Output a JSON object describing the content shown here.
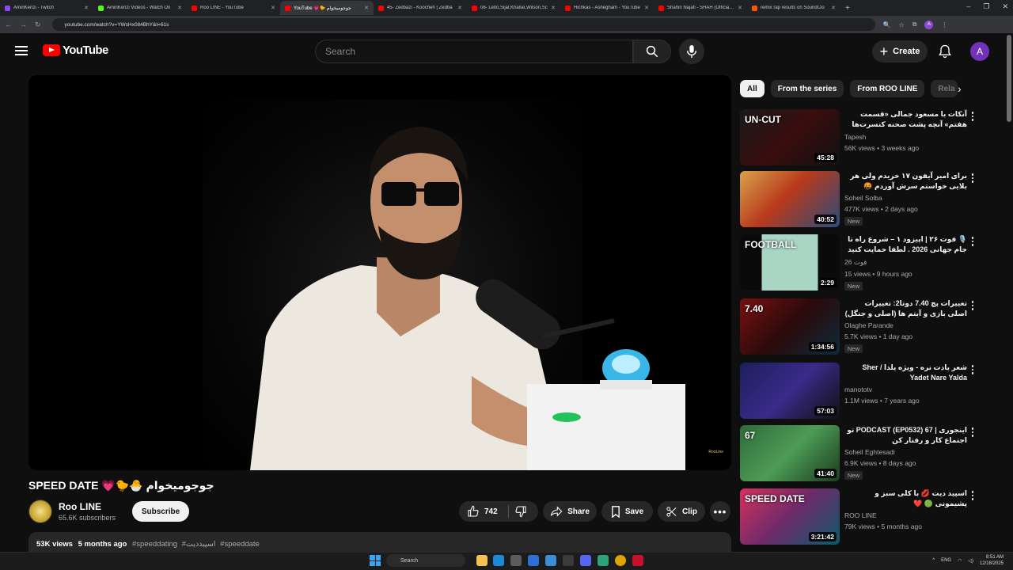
{
  "browser": {
    "tabs": [
      {
        "title": "AminKenzi - Twitch",
        "fav": "tw"
      },
      {
        "title": "AminKenzi Videos - Watch On",
        "fav": "gr"
      },
      {
        "title": "Roo LINE - YouTube",
        "fav": "yt"
      },
      {
        "title": "YouTube 💗🐤 جوجومیخوام",
        "fav": "yt",
        "active": true
      },
      {
        "title": "45- Zedbazi - Koocheh | Zedba",
        "fav": "yt"
      },
      {
        "title": "08- Lelto,Sijal,Khalse,Wilson,Sc",
        "fav": "yt"
      },
      {
        "title": "Hichkas - Ashegham - YouTube",
        "fav": "yt"
      },
      {
        "title": "Shahin Najafi - SHAH (Official M",
        "fav": "yt"
      },
      {
        "title": "remix rap results on SoundClo",
        "fav": "sc"
      }
    ],
    "url": "youtube.com/watch?v=YWsHx084BhY&t=61s",
    "profile_initial": "A"
  },
  "header": {
    "logo_text": "YouTube",
    "search_placeholder": "Search",
    "create_label": "Create",
    "avatar_initial": "A"
  },
  "video": {
    "title": "SPEED DATE 💗🐤🐣 جوجومیخوام",
    "watermark": "RooLine",
    "channel_name": "Roo LINE",
    "subscribers": "65.6K subscribers",
    "subscribe_label": "Subscribe",
    "likes": "742",
    "share_label": "Share",
    "save_label": "Save",
    "clip_label": "Clip",
    "views": "53K views",
    "age": "5 months ago",
    "hashtags": [
      "#speeddating",
      "#اسپیددیت",
      "#speeddate"
    ]
  },
  "chips": [
    "All",
    "From the series",
    "From ROO LINE",
    "Rela"
  ],
  "recommendations": [
    {
      "title": "آنکات با مسعود جمالی «قسمت هفتم» آنچه پشت صحنه کنسرت‌ها گذشت و حرف‌هایی ...",
      "channel": "Tapesh",
      "meta": "56K views • 3 weeks ago",
      "duration": "45:28",
      "new": false,
      "rtl": true,
      "thumb_bg": "linear-gradient(135deg,#1a1a1a 0%,#3a0d0d 50%,#111 100%)",
      "thumb_text": "UN-CUT"
    },
    {
      "title": "برای امیر آیفون ۱۷ خریدم ولی هر بلایی خواستم سرش آوردم 🤬",
      "channel": "Soheil Solba",
      "meta": "477K views • 2 days ago",
      "duration": "40:52",
      "new": true,
      "rtl": true,
      "thumb_bg": "linear-gradient(135deg,#d9a24a 0%,#b83a1c 45%,#2a4c7a 100%)",
      "thumb_text": ""
    },
    {
      "title": "🎙️ فوت ۲۶ | اپیزود ۱ – شروع راه تا جام جهانی 2026 . لطفا حمایت کنید ...",
      "channel": "فوت 26",
      "meta": "15 views • 9 hours ago",
      "duration": "2:29",
      "new": true,
      "rtl": true,
      "thumb_bg": "linear-gradient(90deg,#0a0a0a 0%,#0a0a0a 22%,#a9d6c4 22%,#a9d6c4 78%,#0a0a0a 78%)",
      "thumb_text": "FOOTBALL"
    },
    {
      "title": "تغییرات پچ 7.40 دوتا2: تغییرات اصلی بازی و آیتم ها (اصلی و جنگل)",
      "channel": "Olaghe Parande",
      "meta": "5.7K views • 1 day ago",
      "duration": "1:34:56",
      "new": true,
      "rtl": true,
      "thumb_bg": "linear-gradient(135deg,#7a1010 0%,#2a0a0a 50%,#0d2a3a 100%)",
      "thumb_text": "7.40"
    },
    {
      "title": "شعر یادت نره - ویژه یلدا / Sher Yadet Nare Yalda",
      "channel": "manototv",
      "meta": "1.1M views • 7 years ago",
      "duration": "57:03",
      "new": false,
      "rtl": true,
      "thumb_bg": "linear-gradient(135deg,#1c1f5a 0%,#3a2a8a 50%,#111 100%)",
      "thumb_text": ""
    },
    {
      "title": "اینجوری | 67 PODCAST (EP0532) تو اجتماع کار و رفتار کن",
      "channel": "Soheil Eghtesadi",
      "meta": "6.9K views • 8 days ago",
      "duration": "41:40",
      "new": true,
      "rtl": true,
      "thumb_bg": "linear-gradient(135deg,#2f6b3a 0%,#4d9b54 50%,#1c3a20 100%)",
      "thumb_text": "67"
    },
    {
      "title": "اسپید دیت 💋 با کلی سبز و پشیمونی 🟢 ❤️",
      "channel": "ROO LINE",
      "meta": "79K views • 5 months ago",
      "duration": "3:21:42",
      "new": false,
      "rtl": true,
      "thumb_bg": "linear-gradient(135deg,#d8305c 0%,#6b2a6a 50%,#0d5a6a 100%)",
      "thumb_text": "SPEED DATE"
    }
  ],
  "taskbar": {
    "search_label": "Search",
    "lang": "ENG",
    "time": "8:51 AM",
    "date": "12/18/2025"
  }
}
